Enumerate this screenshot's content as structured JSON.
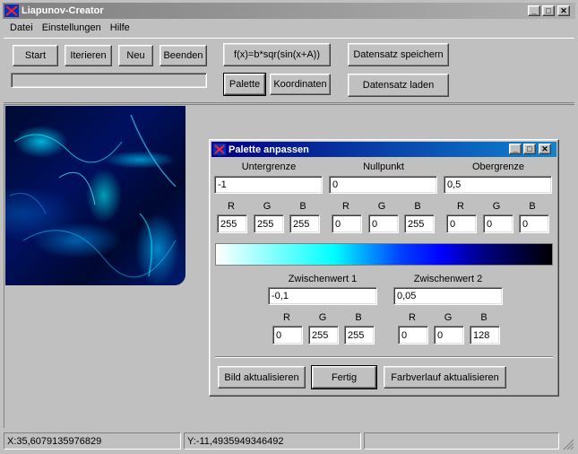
{
  "app": {
    "title": "Liapunov-Creator"
  },
  "menu": [
    "Datei",
    "Einstellungen",
    "Hilfe"
  ],
  "toolbar": {
    "start": "Start",
    "iterieren": "Iterieren",
    "neu": "Neu",
    "beenden": "Beenden",
    "formula": "f(x)=b*sqr(sin(x+A))",
    "palette": "Palette",
    "koordinaten": "Koordinaten",
    "save": "Datensatz speichern",
    "load": "Datensatz laden"
  },
  "dialog": {
    "title": "Palette anpassen",
    "labels": {
      "lower": "Untergrenze",
      "zero": "Nullpunkt",
      "upper": "Obergrenze",
      "mid1": "Zwischenwert 1",
      "mid2": "Zwischenwert 2",
      "r": "R",
      "g": "G",
      "b": "B"
    },
    "values": {
      "lower": "-1",
      "zero": "0",
      "upper": "0,5",
      "lower_rgb": [
        "255",
        "255",
        "255"
      ],
      "zero_rgb": [
        "0",
        "0",
        "255"
      ],
      "upper_rgb": [
        "0",
        "0",
        "0"
      ],
      "mid1": "-0,1",
      "mid2": "0,05",
      "mid1_rgb": [
        "0",
        "255",
        "255"
      ],
      "mid2_rgb": [
        "0",
        "0",
        "128"
      ]
    },
    "buttons": {
      "refresh": "Bild aktualisieren",
      "done": "Fertig",
      "gradient": "Farbverlauf aktualisieren"
    }
  },
  "statusbar": {
    "x": "X:35,6079135976829",
    "y": "Y:-11,4935949346492"
  },
  "colors": {
    "title_active": "#000080",
    "face": "#c0c0c0"
  }
}
